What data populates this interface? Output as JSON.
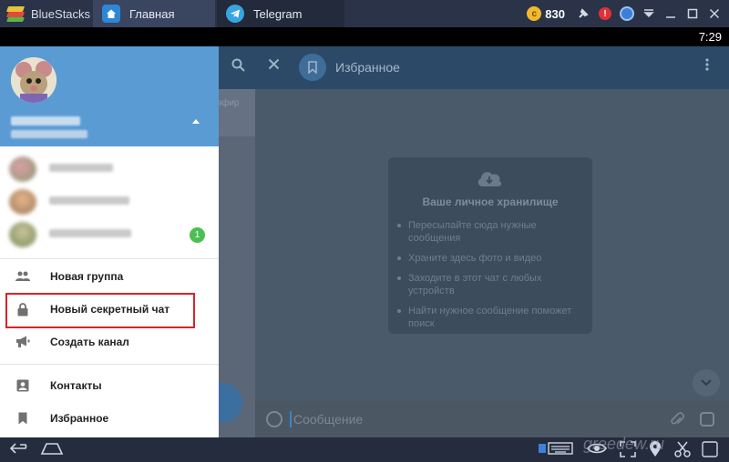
{
  "titlebar": {
    "app_name": "BlueStacks",
    "tabs": [
      {
        "label": "Главная",
        "icon": "home-icon"
      },
      {
        "label": "Telegram",
        "icon": "telegram-icon"
      }
    ],
    "coins": "830",
    "icons": [
      "coin-icon",
      "pin-icon",
      "alert-icon",
      "profile-icon",
      "dropdown-icon",
      "minimize-icon",
      "maximize-icon",
      "close-icon"
    ],
    "alert_symbol": "!"
  },
  "statusbar": {
    "time": "7:29"
  },
  "header": {
    "chat_title": "Избранное",
    "icons": [
      "search-icon",
      "close-icon",
      "bookmark-icon",
      "more-vert-icon"
    ]
  },
  "chat_list": {
    "preview_text": "эфир"
  },
  "info_card": {
    "title": "Ваше личное хранилище",
    "items": [
      "Пересылайте сюда нужные сообщения",
      "Храните здесь фото и видео",
      "Заходите в этот чат с любых устройств",
      "Найти нужное сообщение поможет поиск"
    ]
  },
  "compose": {
    "placeholder": "Сообщение"
  },
  "drawer": {
    "accounts": [
      {
        "badge": ""
      },
      {
        "badge": ""
      },
      {
        "badge": "1"
      }
    ],
    "menu": [
      {
        "label": "Новая группа",
        "icon": "group-icon"
      },
      {
        "label": "Новый секретный чат",
        "icon": "lock-icon"
      },
      {
        "label": "Создать канал",
        "icon": "megaphone-icon"
      },
      {
        "label": "Контакты",
        "icon": "contacts-icon"
      },
      {
        "label": "Избранное",
        "icon": "bookmark-icon"
      }
    ]
  },
  "colors": {
    "drawer_header": "#5a9bd4",
    "highlight": "#d8232a",
    "badge": "#4cbf52",
    "topbar": "#2b3348"
  },
  "watermark": "greedew.ru"
}
